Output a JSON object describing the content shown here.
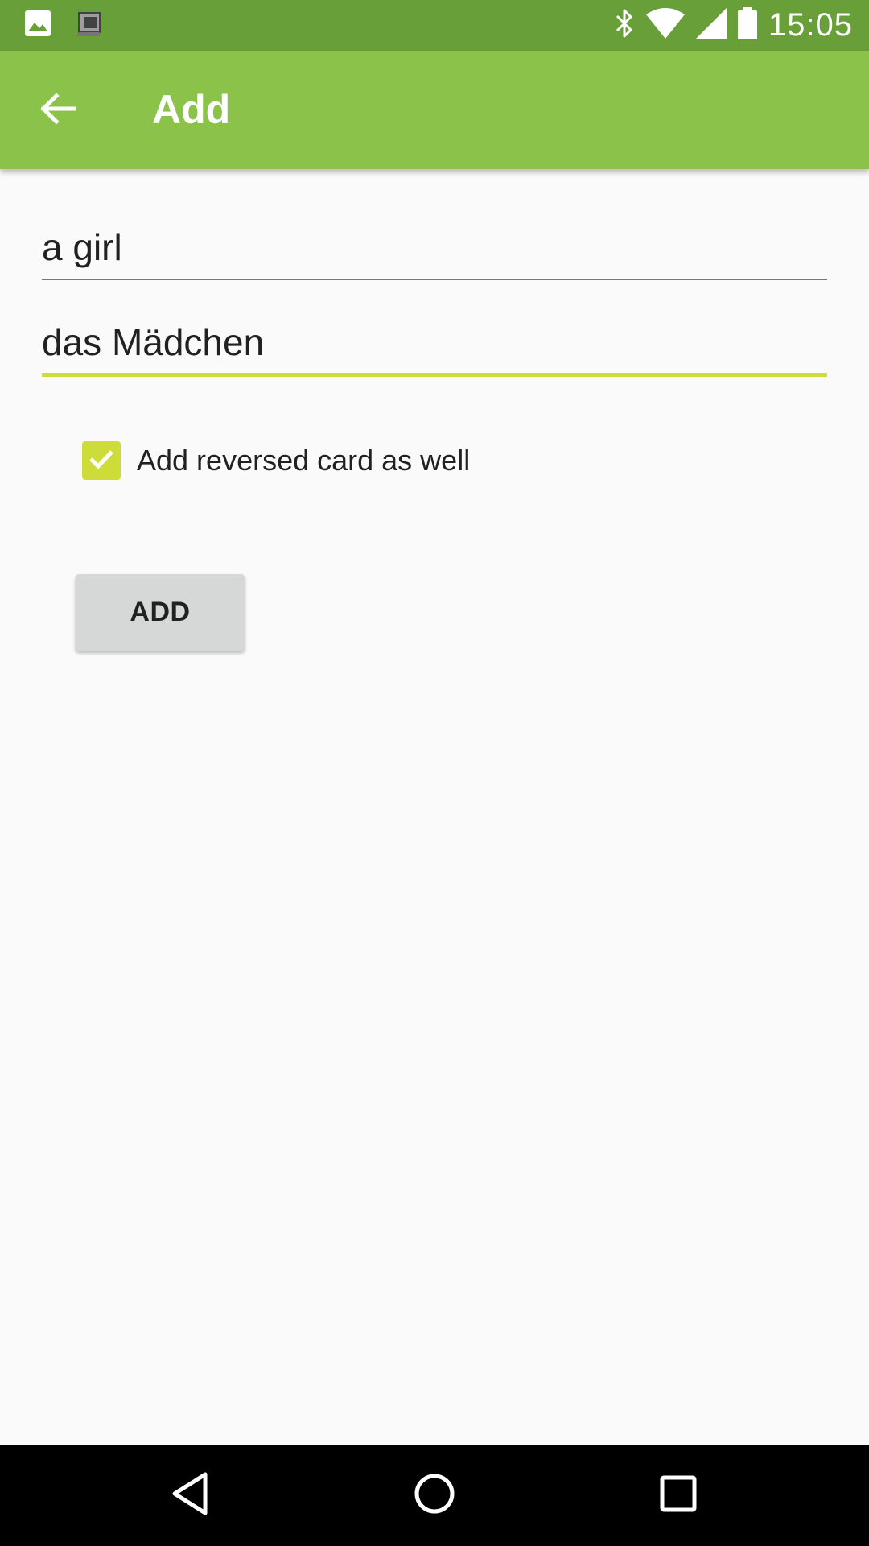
{
  "status_bar": {
    "time": "15:05",
    "left_icons": [
      "image-icon",
      "app-notification-icon"
    ],
    "right_icons": [
      "bluetooth-icon",
      "wifi-icon",
      "cell-signal-icon",
      "battery-icon"
    ],
    "color": "#689f38"
  },
  "app_bar": {
    "title": "Add",
    "back_icon": "arrow-back-icon",
    "color": "#8bc34a"
  },
  "form": {
    "front": {
      "value": "a girl"
    },
    "back": {
      "value": "das Mädchen",
      "focused": true,
      "accent": "#cddc39"
    },
    "reverse_checkbox": {
      "label": "Add reversed card as well",
      "checked": true
    },
    "add_button": {
      "label": "ADD"
    }
  },
  "nav_bar": {
    "buttons": [
      "nav-back-icon",
      "nav-home-icon",
      "nav-recents-icon"
    ]
  }
}
